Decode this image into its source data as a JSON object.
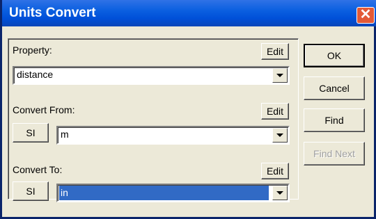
{
  "window": {
    "title": "Units Convert",
    "close_glyph": "✕"
  },
  "property": {
    "label": "Property:",
    "edit_label": "Edit",
    "value": "distance"
  },
  "convert_from": {
    "label": "Convert From:",
    "edit_label": "Edit",
    "si_label": "SI",
    "value": "m"
  },
  "convert_to": {
    "label": "Convert To:",
    "edit_label": "Edit",
    "si_label": "SI",
    "value": "in"
  },
  "buttons": {
    "ok": "OK",
    "cancel": "Cancel",
    "find": "Find",
    "find_next": "Find Next"
  }
}
